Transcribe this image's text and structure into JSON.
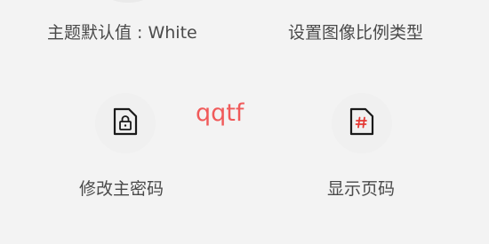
{
  "settings": {
    "theme_default": "主题默认值 : White",
    "image_ratio_type": "设置图像比例类型",
    "change_master_password": "修改主密码",
    "show_page_numbers": "显示页码"
  },
  "overlay": {
    "text": "qqtf"
  },
  "icons": {
    "lock_file": "file-lock-icon",
    "hash_file": "file-hash-icon"
  },
  "colors": {
    "label": "#4a4a4a",
    "icon_stroke": "#1a1a1a",
    "accent_red": "#e53935",
    "overlay_text": "#f05a5a",
    "background": "#f3f3f3"
  }
}
